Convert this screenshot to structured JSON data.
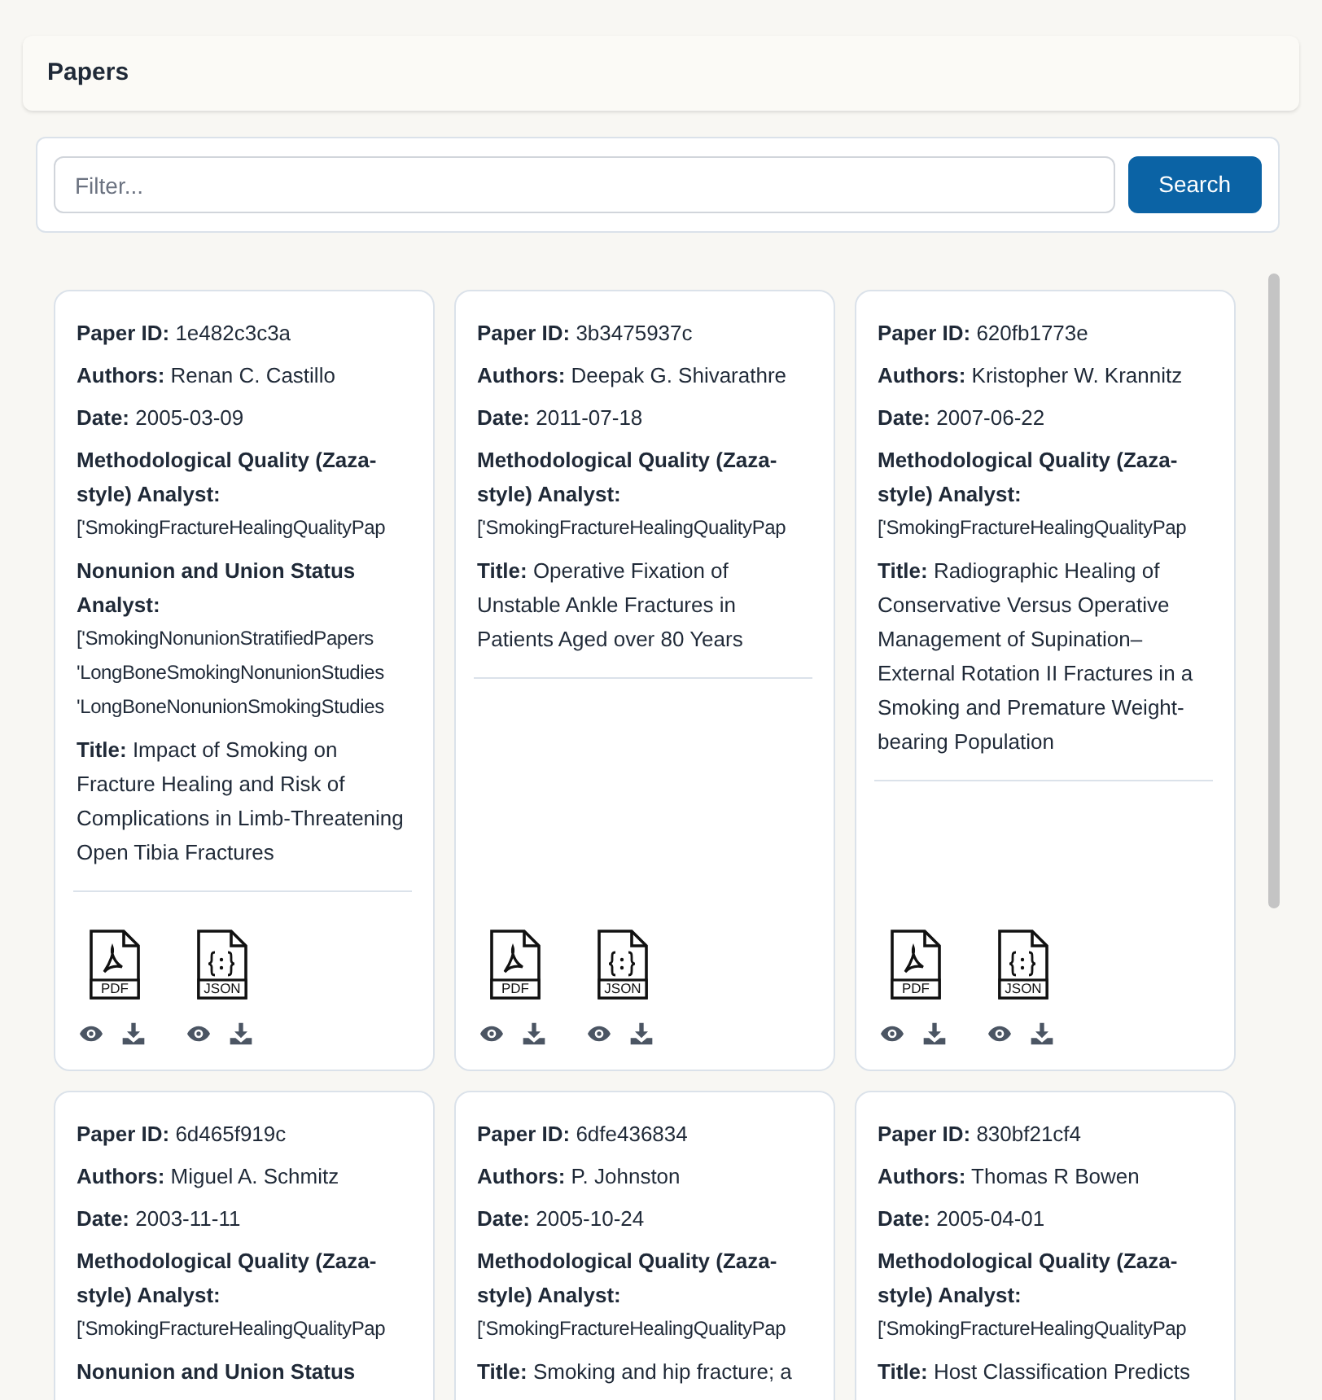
{
  "header": {
    "title": "Papers"
  },
  "filter": {
    "placeholder": "Filter...",
    "button": "Search"
  },
  "papers": [
    {
      "fields": [
        {
          "kind": "inline",
          "label": "Paper ID:",
          "value": "1e482c3c3a"
        },
        {
          "kind": "inline",
          "label": "Authors:",
          "value": "Renan C. Castillo"
        },
        {
          "kind": "inline",
          "label": "Date:",
          "value": "2005-03-09"
        },
        {
          "kind": "list",
          "label": "Methodological Quality (Zaza-style) Analyst:",
          "lines": [
            "['SmokingFractureHealingQualityPap"
          ]
        },
        {
          "kind": "list",
          "label": "Nonunion and Union Status Analyst:",
          "lines": [
            "['SmokingNonunionStratifiedPapers",
            "'LongBoneSmokingNonunionStudies",
            "'LongBoneNonunionSmokingStudies"
          ]
        },
        {
          "kind": "inline",
          "label": "Title:",
          "value": "Impact of Smoking on Fracture Healing and Risk of Complications in Limb-Threatening Open Tibia Fractures"
        }
      ],
      "files": [
        {
          "label": "PDF",
          "kind": "pdf"
        },
        {
          "label": "JSON",
          "kind": "json"
        }
      ]
    },
    {
      "fields": [
        {
          "kind": "inline",
          "label": "Paper ID:",
          "value": "3b3475937c"
        },
        {
          "kind": "inline",
          "label": "Authors:",
          "value": "Deepak G. Shivarathre"
        },
        {
          "kind": "inline",
          "label": "Date:",
          "value": "2011-07-18"
        },
        {
          "kind": "list",
          "label": "Methodological Quality (Zaza-style) Analyst:",
          "lines": [
            "['SmokingFractureHealingQualityPap"
          ]
        },
        {
          "kind": "inline",
          "label": "Title:",
          "value": "Operative Fixation of Unstable Ankle Fractures in Patients Aged over 80 Years"
        }
      ],
      "files": [
        {
          "label": "PDF",
          "kind": "pdf"
        },
        {
          "label": "JSON",
          "kind": "json"
        }
      ]
    },
    {
      "fields": [
        {
          "kind": "inline",
          "label": "Paper ID:",
          "value": "620fb1773e"
        },
        {
          "kind": "inline",
          "label": "Authors:",
          "value": "Kristopher W. Krannitz"
        },
        {
          "kind": "inline",
          "label": "Date:",
          "value": "2007-06-22"
        },
        {
          "kind": "list",
          "label": "Methodological Quality (Zaza-style) Analyst:",
          "lines": [
            "['SmokingFractureHealingQualityPap"
          ]
        },
        {
          "kind": "inline",
          "label": "Title:",
          "value": "Radiographic Healing of Conservative Versus Operative Management of Supination–External Rotation II Fractures in a Smoking and Premature Weight-bearing Population"
        }
      ],
      "files": [
        {
          "label": "PDF",
          "kind": "pdf"
        },
        {
          "label": "JSON",
          "kind": "json"
        }
      ]
    },
    {
      "fields": [
        {
          "kind": "inline",
          "label": "Paper ID:",
          "value": "6d465f919c"
        },
        {
          "kind": "inline",
          "label": "Authors:",
          "value": "Miguel A. Schmitz"
        },
        {
          "kind": "inline",
          "label": "Date:",
          "value": "2003-11-11"
        },
        {
          "kind": "list",
          "label": "Methodological Quality (Zaza-style) Analyst:",
          "lines": [
            "['SmokingFractureHealingQualityPap"
          ]
        },
        {
          "kind": "inline",
          "label": "Nonunion and Union Status"
        }
      ]
    },
    {
      "fields": [
        {
          "kind": "inline",
          "label": "Paper ID:",
          "value": "6dfe436834"
        },
        {
          "kind": "inline",
          "label": "Authors:",
          "value": "P. Johnston"
        },
        {
          "kind": "inline",
          "label": "Date:",
          "value": "2005-10-24"
        },
        {
          "kind": "list",
          "label": "Methodological Quality (Zaza-style) Analyst:",
          "lines": [
            "['SmokingFractureHealingQualityPap"
          ]
        },
        {
          "kind": "inline",
          "label": "Title:",
          "value": "Smoking and hip fracture; a"
        }
      ]
    },
    {
      "fields": [
        {
          "kind": "inline",
          "label": "Paper ID:",
          "value": "830bf21cf4"
        },
        {
          "kind": "inline",
          "label": "Authors:",
          "value": "Thomas R Bowen"
        },
        {
          "kind": "inline",
          "label": "Date:",
          "value": "2005-04-01"
        },
        {
          "kind": "list",
          "label": "Methodological Quality (Zaza-style) Analyst:",
          "lines": [
            "['SmokingFractureHealingQualityPap"
          ]
        },
        {
          "kind": "inline",
          "label": "Title:",
          "value": "Host Classification Predicts"
        }
      ]
    }
  ]
}
